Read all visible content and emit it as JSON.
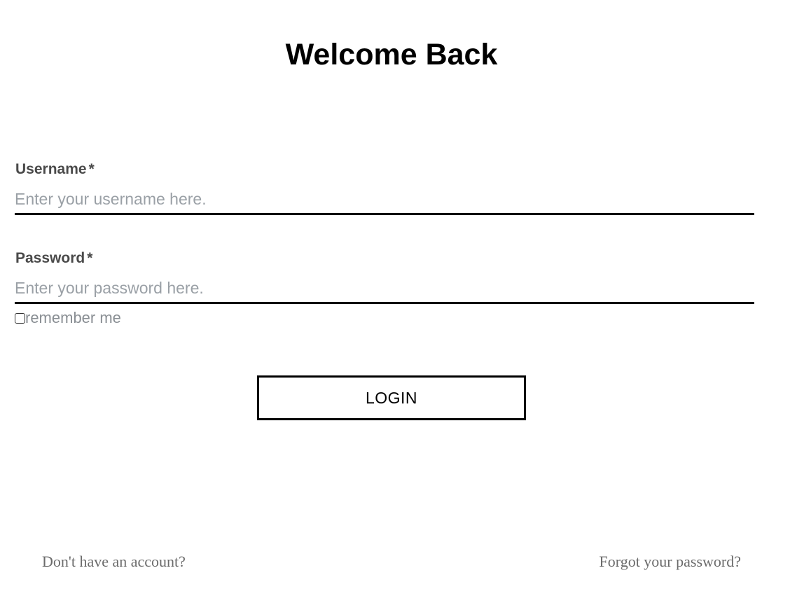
{
  "page": {
    "title": "Welcome Back"
  },
  "form": {
    "username": {
      "label": "Username",
      "required_mark": "*",
      "value": "",
      "placeholder": "Enter your username here."
    },
    "password": {
      "label": "Password",
      "required_mark": "*",
      "value": "",
      "placeholder": "Enter your password here."
    },
    "remember_me": {
      "label": "remember me",
      "checked": false
    },
    "login_button_label": "LOGIN"
  },
  "footer": {
    "signup_text": "Don't have an account?",
    "forgot_text": "Forgot your password?"
  },
  "colors": {
    "label_text": "#4a4a4a",
    "placeholder_text": "#9aa0a6",
    "footer_link_text": "#6b6b6b",
    "underline": "#000000"
  }
}
